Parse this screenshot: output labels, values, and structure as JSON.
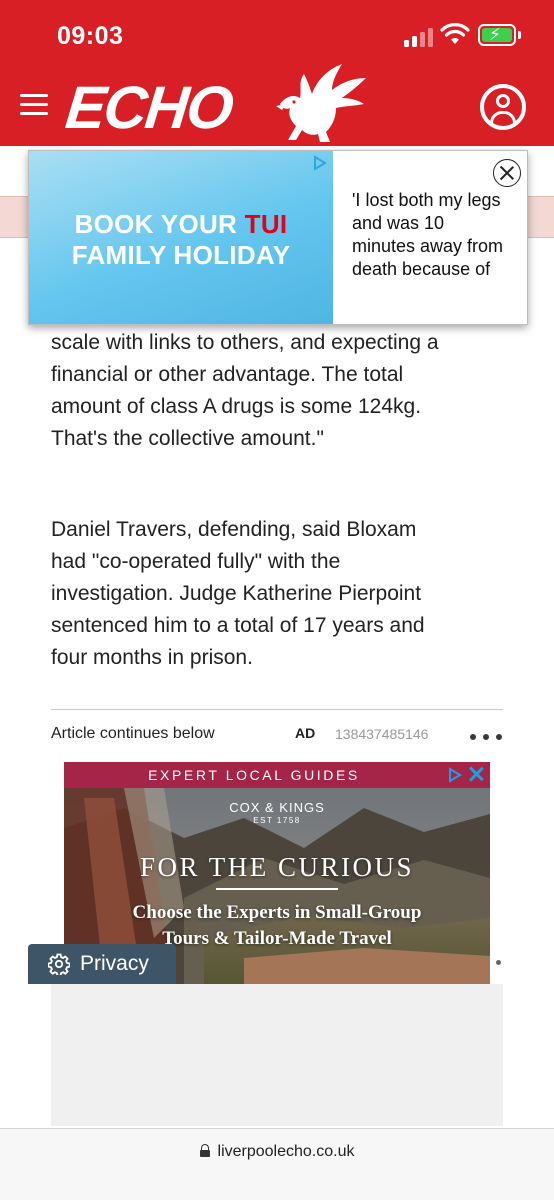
{
  "status_bar": {
    "time": "09:03"
  },
  "header": {
    "logo_text": "ECHO",
    "background_color": "#d91f26"
  },
  "top_ad": {
    "image_line1_prefix": "BOOK YOUR ",
    "image_line1_brand": "TUI",
    "image_line2": "FAMILY HOLIDAY",
    "copy_lines": [
      "'I lost both my legs",
      "and was 10",
      "minutes away from",
      "death because of"
    ]
  },
  "article": {
    "paragraph1": [
      "scale with links to others, and expecting a",
      "financial or other advantage. The total",
      "amount of class A drugs is some 124kg.",
      "That's the collective amount.\""
    ],
    "paragraph2": [
      "Daniel Travers, defending, said Bloxam",
      "had \"co-operated fully\" with the",
      "investigation. Judge Katherine Pierpoint",
      "sentenced him to a total of 17 years and",
      "four months in prison."
    ]
  },
  "ad_slot": {
    "continues_label": "Article continues below",
    "ad_tag": "AD",
    "ad_id": "138437485146"
  },
  "ck_ad": {
    "band_text": "EXPERT LOCAL GUIDES",
    "brand": "COX & KINGS",
    "brand_sub": "EST 1758",
    "headline": "FOR THE CURIOUS",
    "sub_line1": "Choose the Experts in Small-Group",
    "sub_line2": "Tours & Tailor-Made Travel"
  },
  "privacy": {
    "label": "Privacy"
  },
  "browser": {
    "url": "liverpoolecho.co.uk"
  }
}
